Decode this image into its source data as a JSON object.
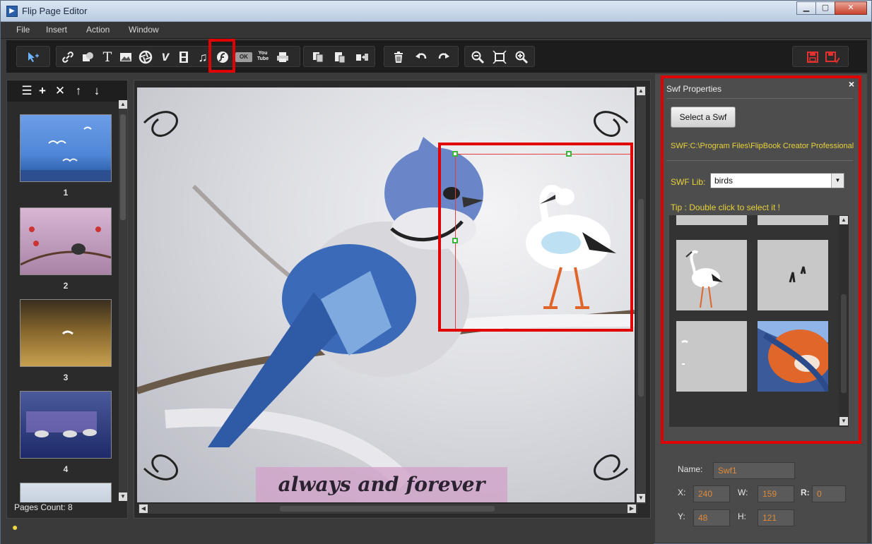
{
  "window": {
    "title": "Flip Page Editor",
    "minimize_glyph": "▁",
    "maximize_glyph": "▢",
    "close_glyph": "✕"
  },
  "menu": {
    "items": [
      "File",
      "Insert",
      "Action",
      "Window"
    ]
  },
  "toolbar": {
    "ok_label": "OK",
    "youtube_label": "You Tube",
    "text_tool_glyph": "T",
    "vimeo_glyph": "v",
    "music_glyph": "♫"
  },
  "left_panel": {
    "tools": [
      "☰",
      "+",
      "✕",
      "↑",
      "↓"
    ],
    "thumbnails": [
      {
        "number": "1"
      },
      {
        "number": "2"
      },
      {
        "number": "3"
      },
      {
        "number": "4"
      }
    ],
    "pages_count": "Pages Count: 8"
  },
  "canvas": {
    "caption": "always and forever"
  },
  "swf_panel": {
    "title": "Swf Properties",
    "close_glyph": "×",
    "select_button": "Select a Swf",
    "swf_path": "SWF:C:\\Program Files\\FlipBook Creator Professional",
    "lib_label": "SWF Lib:",
    "lib_selected": "birds",
    "tip": "Tip : Double click to select it !"
  },
  "properties": {
    "name_label": "Name:",
    "name_value": "Swf1",
    "x_label": "X:",
    "x_value": "240",
    "w_label": "W:",
    "w_value": "159",
    "r_label": "R:",
    "r_value": "0",
    "y_label": "Y:",
    "y_value": "48",
    "h_label": "H:",
    "h_value": "121"
  },
  "colors": {
    "highlight": "#e00000",
    "label_yellow": "#e8d23a",
    "value_orange": "#e08a3a",
    "handle_green": "#3bb53b"
  }
}
